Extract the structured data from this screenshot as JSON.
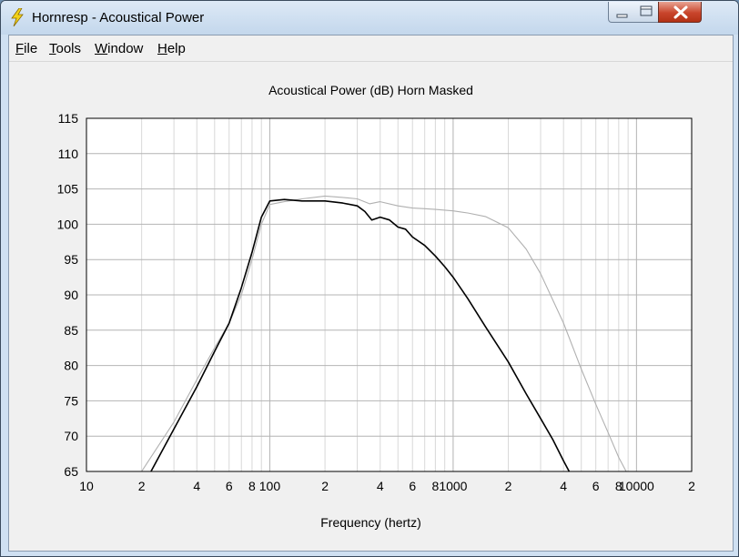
{
  "window": {
    "title": "Hornresp - Acoustical Power"
  },
  "menu": [
    {
      "accel": "F",
      "rest": "ile"
    },
    {
      "accel": "T",
      "rest": "ools"
    },
    {
      "accel": "W",
      "rest": "indow"
    },
    {
      "accel": "H",
      "rest": "elp"
    }
  ],
  "colors": {
    "titlebar": "#c9dcef",
    "close_button": "#c9452c",
    "plot_background": "#ffffff",
    "grid_major": "#b4b4b4",
    "grid_minor": "#d8d8d8",
    "series_black": "#000000",
    "series_grey": "#b0b0b0"
  },
  "icons": [
    "lightning-bolt-icon",
    "minimize-icon",
    "maximize-icon",
    "close-icon"
  ],
  "chart_data": {
    "type": "line",
    "title": "Acoustical Power (dB)   Horn   Masked",
    "xlabel": "Frequency (hertz)",
    "ylabel": "",
    "x_scale": "log",
    "xlim": [
      10,
      20000
    ],
    "ylim": [
      65,
      115
    ],
    "y_ticks": [
      115,
      110,
      105,
      100,
      95,
      90,
      85,
      80,
      75,
      70,
      65
    ],
    "x_ticks": [
      {
        "value": 10,
        "label": "10"
      },
      {
        "value": 20,
        "label": "2"
      },
      {
        "value": 40,
        "label": "4"
      },
      {
        "value": 60,
        "label": "6"
      },
      {
        "value": 80,
        "label": "8"
      },
      {
        "value": 100,
        "label": "100"
      },
      {
        "value": 200,
        "label": "2"
      },
      {
        "value": 400,
        "label": "4"
      },
      {
        "value": 600,
        "label": "6"
      },
      {
        "value": 800,
        "label": "8"
      },
      {
        "value": 1000,
        "label": "1000"
      },
      {
        "value": 2000,
        "label": "2"
      },
      {
        "value": 4000,
        "label": "4"
      },
      {
        "value": 6000,
        "label": "6"
      },
      {
        "value": 8000,
        "label": "8"
      },
      {
        "value": 10000,
        "label": "10000"
      },
      {
        "value": 20000,
        "label": "2"
      }
    ],
    "grid": true,
    "series": [
      {
        "color": "#000000",
        "x": [
          22.5,
          30,
          40,
          50,
          60,
          70,
          80,
          90,
          100,
          120,
          150,
          200,
          250,
          300,
          330,
          360,
          400,
          450,
          500,
          550,
          600,
          700,
          800,
          900,
          1000,
          1200,
          1500,
          2000,
          2500,
          3000,
          3500,
          4000,
          4400
        ],
        "y": [
          65,
          71,
          77,
          82,
          86,
          91,
          96,
          101,
          103.3,
          103.5,
          103.3,
          103.3,
          103.0,
          102.6,
          101.8,
          100.6,
          101.0,
          100.6,
          99.6,
          99.3,
          98.2,
          97.0,
          95.5,
          94.0,
          92.5,
          89.5,
          85.5,
          80.5,
          76.0,
          72.5,
          69.5,
          66.5,
          64.5
        ]
      },
      {
        "color": "#b0b0b0",
        "x": [
          20,
          30,
          40,
          50,
          60,
          70,
          80,
          90,
          100,
          120,
          150,
          200,
          250,
          300,
          350,
          400,
          500,
          600,
          700,
          800,
          1000,
          1200,
          1500,
          2000,
          2500,
          3000,
          4000,
          5000,
          6000,
          7000,
          8000,
          9000
        ],
        "y": [
          65,
          72,
          78,
          82.5,
          86,
          90,
          95,
          100,
          102.8,
          103.2,
          103.6,
          104.0,
          103.8,
          103.6,
          102.9,
          103.2,
          102.6,
          102.3,
          102.2,
          102.1,
          101.9,
          101.6,
          101.1,
          99.5,
          96.5,
          93.0,
          86.0,
          79.5,
          74.5,
          70.5,
          67.0,
          64.5
        ]
      }
    ]
  }
}
